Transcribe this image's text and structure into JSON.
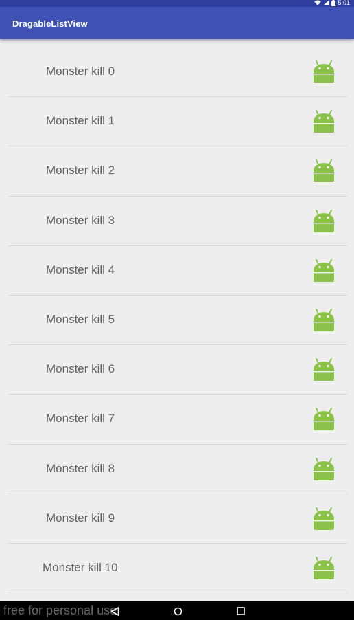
{
  "status_bar": {
    "time": "5:01"
  },
  "app_bar": {
    "title": "DragableListView"
  },
  "list": {
    "items": [
      {
        "label": "Monster kill 0",
        "icon": "android-icon"
      },
      {
        "label": "Monster kill 1",
        "icon": "android-icon"
      },
      {
        "label": "Monster kill 2",
        "icon": "android-icon"
      },
      {
        "label": "Monster kill 3",
        "icon": "android-icon"
      },
      {
        "label": "Monster kill 4",
        "icon": "android-icon"
      },
      {
        "label": "Monster kill 5",
        "icon": "android-icon"
      },
      {
        "label": "Monster kill 6",
        "icon": "android-icon"
      },
      {
        "label": "Monster kill 7",
        "icon": "android-icon"
      },
      {
        "label": "Monster kill 8",
        "icon": "android-icon"
      },
      {
        "label": "Monster kill 9",
        "icon": "android-icon"
      },
      {
        "label": "Monster kill 10",
        "icon": "android-icon"
      }
    ]
  },
  "nav_bar": {
    "watermark": "free for personal use",
    "buttons": [
      "back-icon",
      "home-icon",
      "recents-icon"
    ]
  },
  "colors": {
    "primary": "#3f51b5",
    "primary_dark": "#303f9f",
    "android_green": "#8bc34a",
    "background": "#eeeeee"
  }
}
